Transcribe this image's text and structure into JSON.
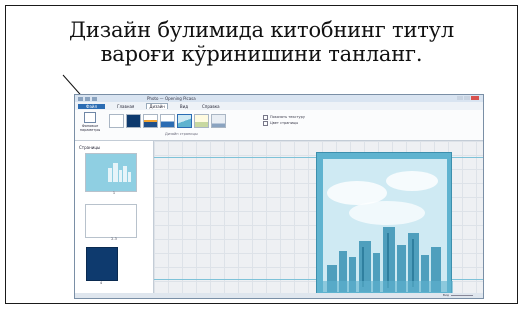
{
  "caption": {
    "line1": "Дизайн булимида китобнинг титул",
    "line2": "вароғи кўринишини танланг."
  },
  "app": {
    "title": "Photo — Opening Picasa",
    "tabs": [
      "Файл",
      "Главная",
      "Дизайн",
      "Вид",
      "Справка"
    ],
    "active_tab": "Дизайн"
  },
  "ribbon": {
    "main_button": "Фоновые параметры",
    "group_label": "Дизайн страницы",
    "option_1": "Показать текстуру",
    "option_2": "Цвет страницы"
  },
  "panel": {
    "title": "Страницы",
    "pages": [
      {
        "number": "1"
      },
      {
        "number": "2-3"
      },
      {
        "number": "4"
      }
    ]
  },
  "status": {
    "zoom_label": "Вид"
  },
  "colors": {
    "page_fill": "#5fb3cf",
    "accent": "#2b6cb3",
    "guide": "#7ec2d8",
    "dark_cover": "#0e3a6e"
  },
  "icons": [
    "arrow-pointer-icon",
    "background-options-icon",
    "city-skyline-icon"
  ]
}
